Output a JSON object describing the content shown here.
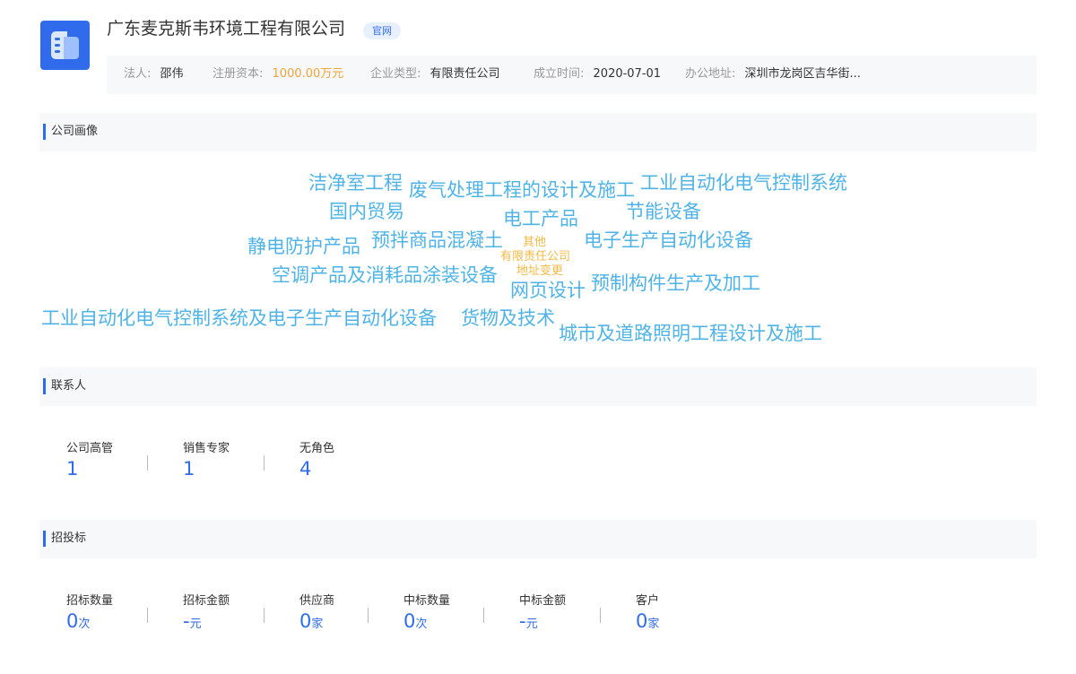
{
  "header": {
    "company_name": "广东麦克斯韦环境工程有限公司",
    "official_badge": "官网",
    "logo_icon": "building-icon"
  },
  "info": {
    "legal_rep_label": "法人:",
    "legal_rep_value": "邵伟",
    "capital_label": "注册资本:",
    "capital_value": "1000.00万元",
    "type_label": "企业类型:",
    "type_value": "有限责任公司",
    "founded_label": "成立时间:",
    "founded_value": "2020-07-01",
    "address_label": "办公地址:",
    "address_value": "深圳市龙岗区吉华街..."
  },
  "portrait": {
    "title": "公司画像",
    "words": [
      "洁净室工程",
      "废气处理工程的设计及施工",
      "工业自动化电气控制系统",
      "国内贸易",
      "电工产品",
      "节能设备",
      "静电防护产品",
      "预拌商品混凝土",
      "其他",
      "电子生产自动化设备",
      "有限责任公司",
      "地址变更",
      "空调产品及消耗品涂装设备",
      "网页设计",
      "预制构件生产及加工",
      "工业自动化电气控制系统及电子生产自动化设备",
      "货物及技术",
      "城市及道路照明工程设计及施工"
    ]
  },
  "contacts": {
    "title": "联系人",
    "stats": [
      {
        "label": "公司高管",
        "value": "1"
      },
      {
        "label": "销售专家",
        "value": "1"
      },
      {
        "label": "无角色",
        "value": "4"
      }
    ]
  },
  "bidding": {
    "title": "招投标",
    "stats": [
      {
        "label": "招标数量",
        "value": "0",
        "unit": "次"
      },
      {
        "label": "招标金额",
        "value": "-",
        "unit": "元"
      },
      {
        "label": "供应商",
        "value": "0",
        "unit": "家"
      },
      {
        "label": "中标数量",
        "value": "0",
        "unit": "次"
      },
      {
        "label": "中标金额",
        "value": "-",
        "unit": "元"
      },
      {
        "label": "客户",
        "value": "0",
        "unit": "家"
      }
    ]
  },
  "colors": {
    "accent": "#2f6bea",
    "cloud_blue": "#4fb3e6",
    "cloud_orange": "#f2b944",
    "capital_orange": "#f2a33a"
  }
}
